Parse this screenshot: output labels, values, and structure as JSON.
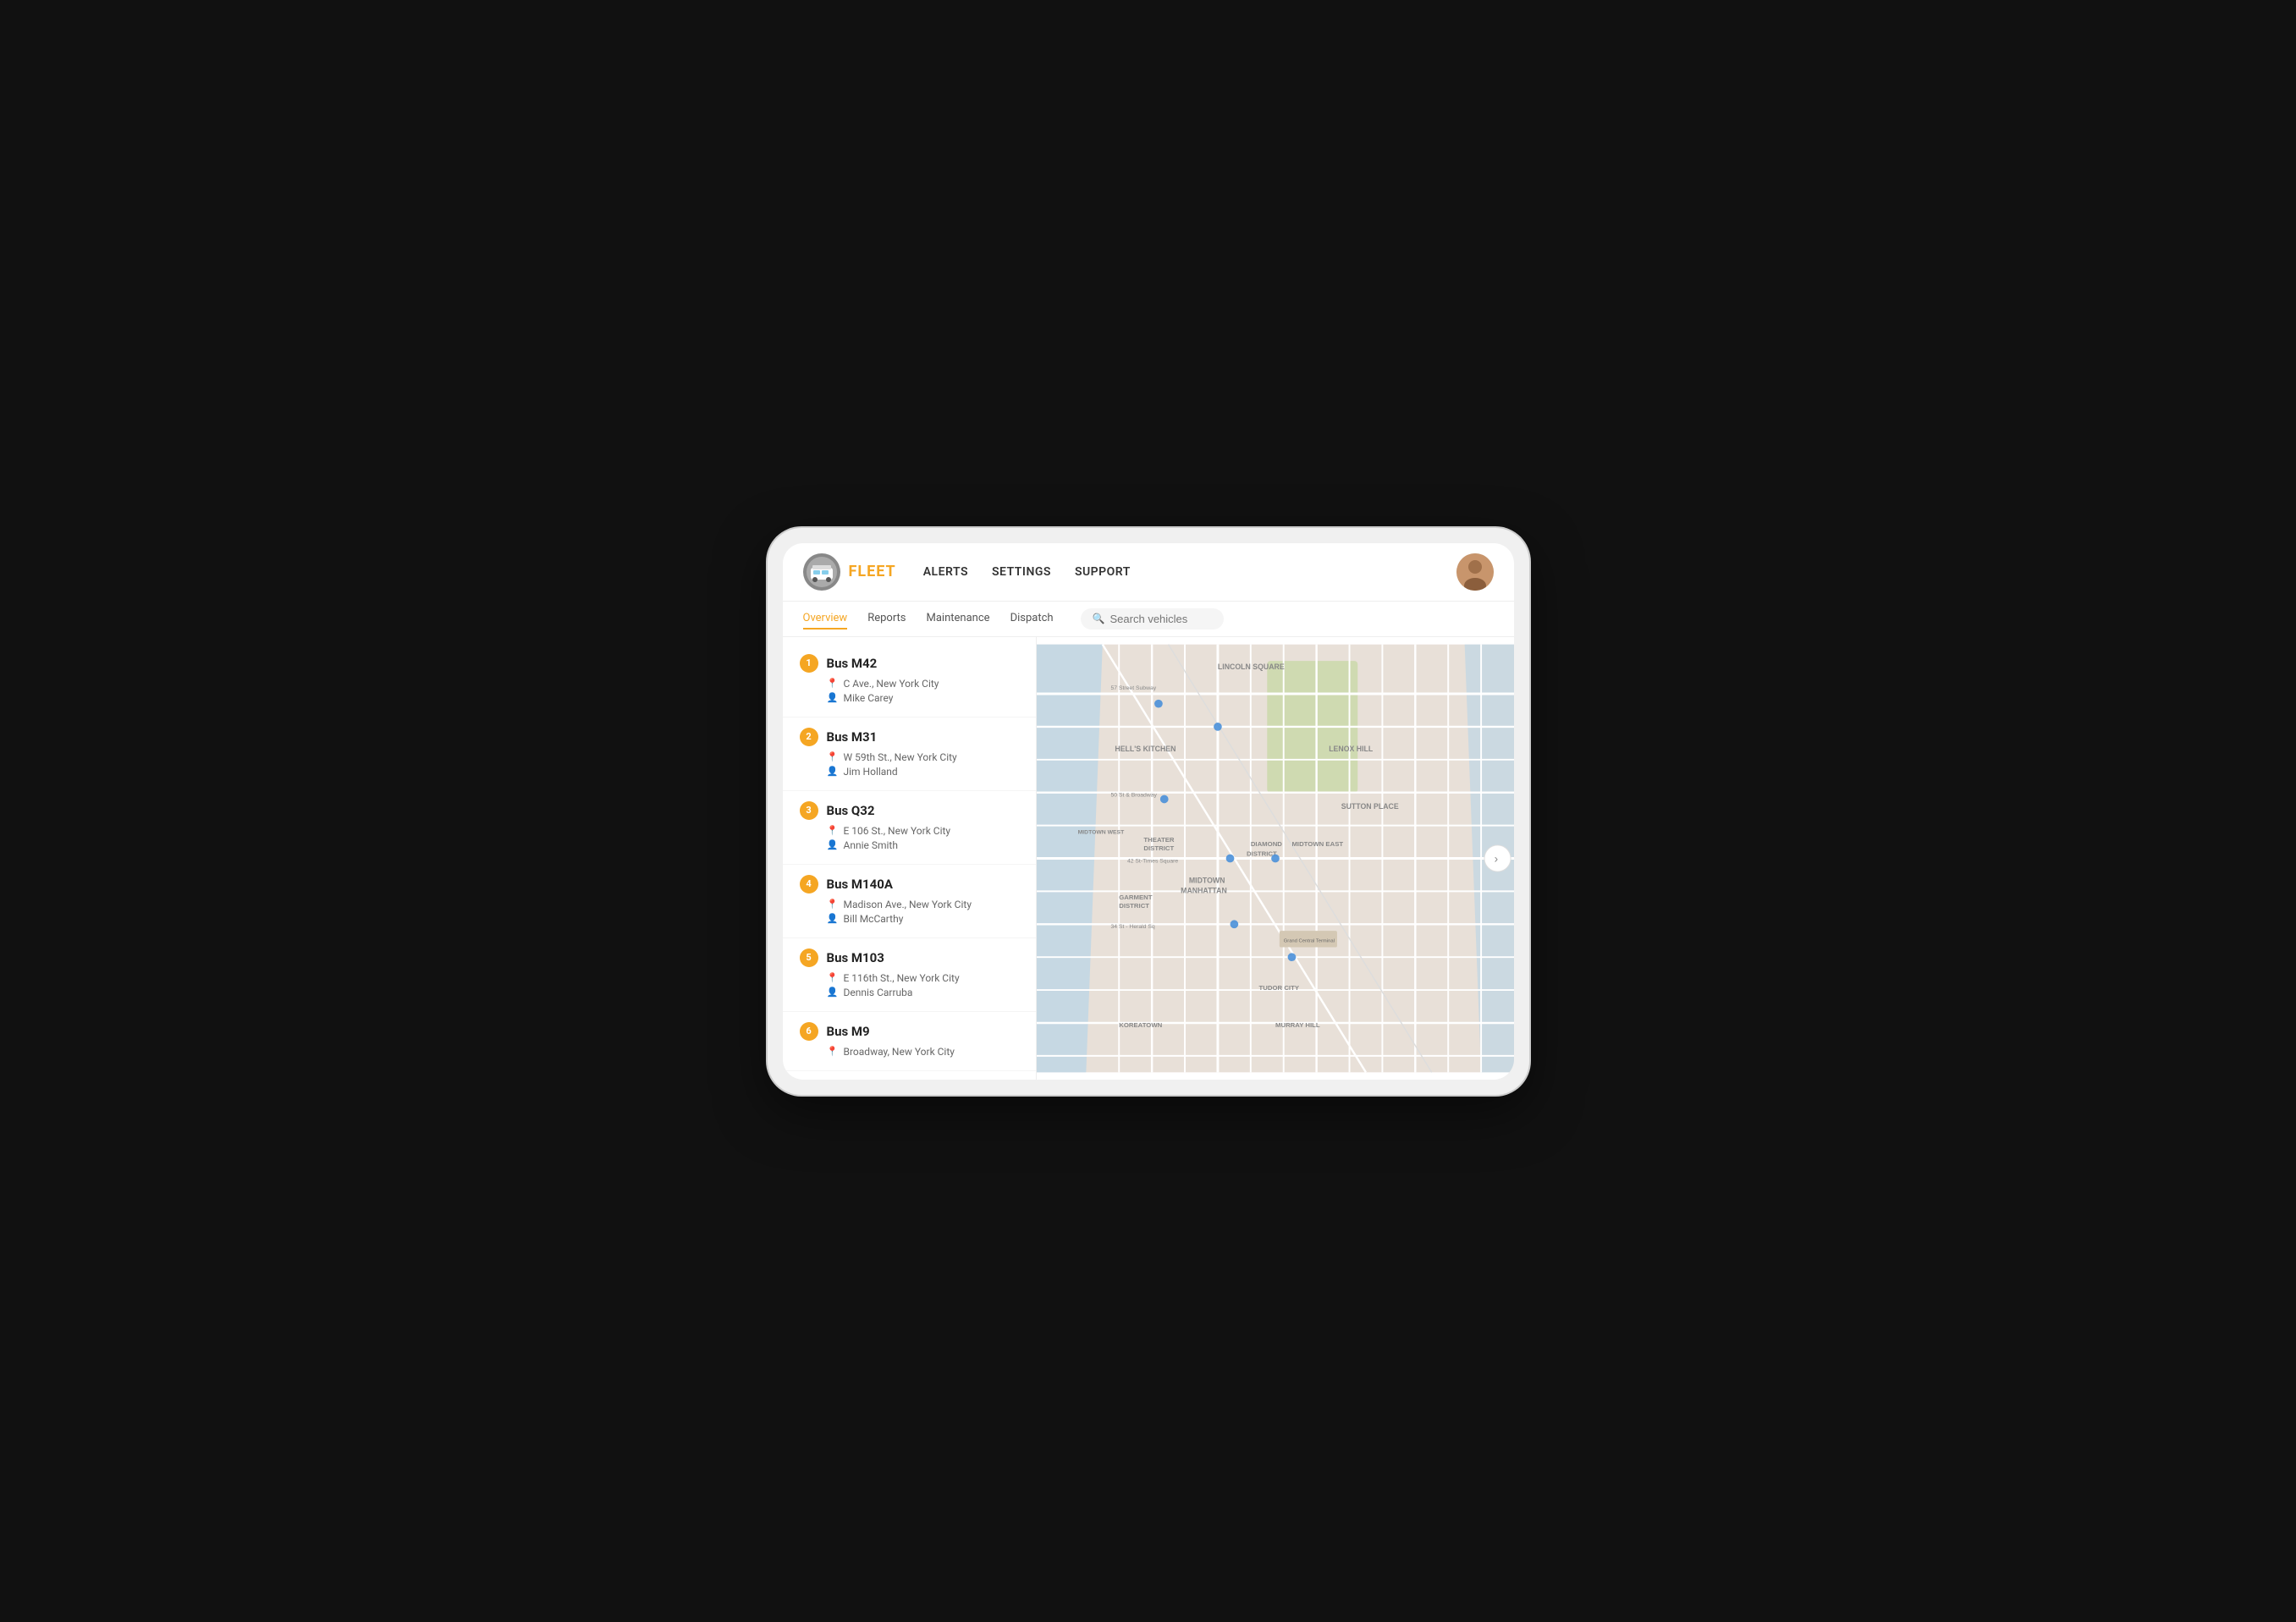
{
  "brand": {
    "name": "FLEET",
    "logo_alt": "fleet-truck-logo"
  },
  "header_nav": {
    "items": [
      {
        "id": "alerts",
        "label": "ALERTS"
      },
      {
        "id": "settings",
        "label": "SETTINGS"
      },
      {
        "id": "support",
        "label": "SUPPORT"
      }
    ]
  },
  "subnav": {
    "items": [
      {
        "id": "overview",
        "label": "Overview",
        "active": true
      },
      {
        "id": "reports",
        "label": "Reports",
        "active": false
      },
      {
        "id": "maintenance",
        "label": "Maintenance",
        "active": false
      },
      {
        "id": "dispatch",
        "label": "Dispatch",
        "active": false
      }
    ],
    "search_placeholder": "Search vehicles"
  },
  "vehicles": [
    {
      "number": "1",
      "name": "Bus M42",
      "location": "C Ave., New York City",
      "driver": "Mike Carey"
    },
    {
      "number": "2",
      "name": "Bus M31",
      "location": "W 59th St., New York City",
      "driver": "Jim Holland"
    },
    {
      "number": "3",
      "name": "Bus Q32",
      "location": "E 106 St., New York City",
      "driver": "Annie Smith"
    },
    {
      "number": "4",
      "name": "Bus M140A",
      "location": "Madison Ave., New York City",
      "driver": "Bill McCarthy"
    },
    {
      "number": "5",
      "name": "Bus M103",
      "location": "E 116th St., New York City",
      "driver": "Dennis Carruba"
    },
    {
      "number": "6",
      "name": "Bus M9",
      "location": "Broadway, New York City",
      "driver": ""
    }
  ],
  "colors": {
    "accent": "#f5a623",
    "text_primary": "#222",
    "text_secondary": "#666",
    "border": "#eee"
  }
}
